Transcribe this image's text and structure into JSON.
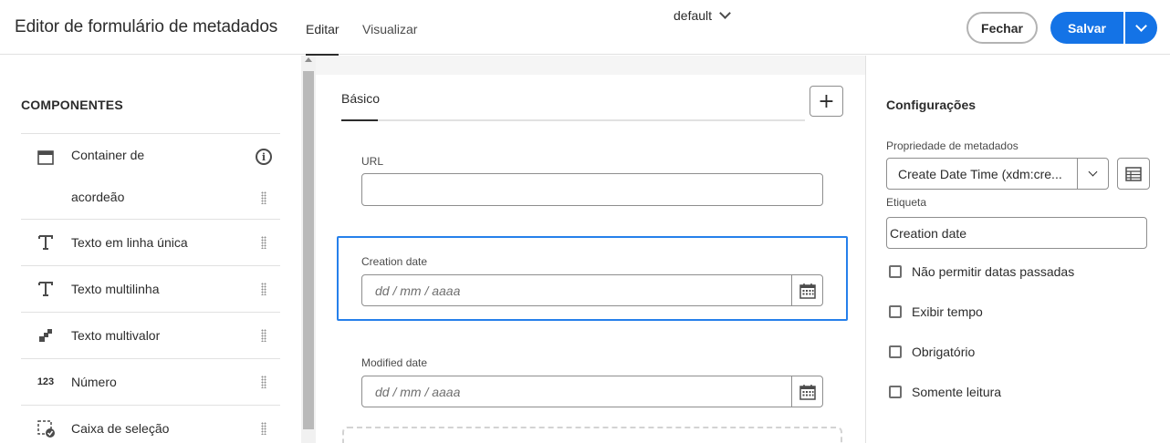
{
  "header": {
    "title": "Editor de formulário de metadados",
    "tabs": [
      {
        "label": "Editar",
        "active": true
      },
      {
        "label": "Visualizar",
        "active": false
      }
    ],
    "form_selector": "default",
    "close_label": "Fechar",
    "save_label": "Salvar"
  },
  "components": {
    "title": "COMPONENTES",
    "items": [
      {
        "label_line1": "Container de",
        "label_line2": "acordeão",
        "icon": "accordion-container-icon"
      },
      {
        "label": "Texto em linha única",
        "icon": "text-icon"
      },
      {
        "label": "Texto multilinha",
        "icon": "text-icon"
      },
      {
        "label": "Texto multivalor",
        "icon": "multivalue-icon"
      },
      {
        "label": "Número",
        "icon": "number-icon",
        "glyph": "123"
      },
      {
        "label": "Caixa de seleção",
        "icon": "checkbox-icon"
      }
    ]
  },
  "canvas": {
    "tab_label": "Básico",
    "add_tab_symbol": "+",
    "fields": [
      {
        "label": "URL",
        "type": "text",
        "value": ""
      },
      {
        "label": "Creation date",
        "type": "date",
        "placeholder": "dd / mm / aaaa",
        "selected": true
      },
      {
        "label": "Modified date",
        "type": "date",
        "placeholder": "dd / mm / aaaa",
        "selected": false
      }
    ]
  },
  "settings": {
    "title": "Configurações",
    "property_label": "Propriedade de metadados",
    "property_value": "Create Date Time (xdm:cre...",
    "label_label": "Etiqueta",
    "label_value": "Creation date",
    "checkboxes": [
      {
        "label": "Não permitir datas passadas",
        "checked": false
      },
      {
        "label": "Exibir tempo",
        "checked": false
      },
      {
        "label": "Obrigatório",
        "checked": false
      },
      {
        "label": "Somente leitura",
        "checked": false
      }
    ]
  },
  "colors": {
    "accent": "#1473e6",
    "selection": "#2680eb"
  }
}
